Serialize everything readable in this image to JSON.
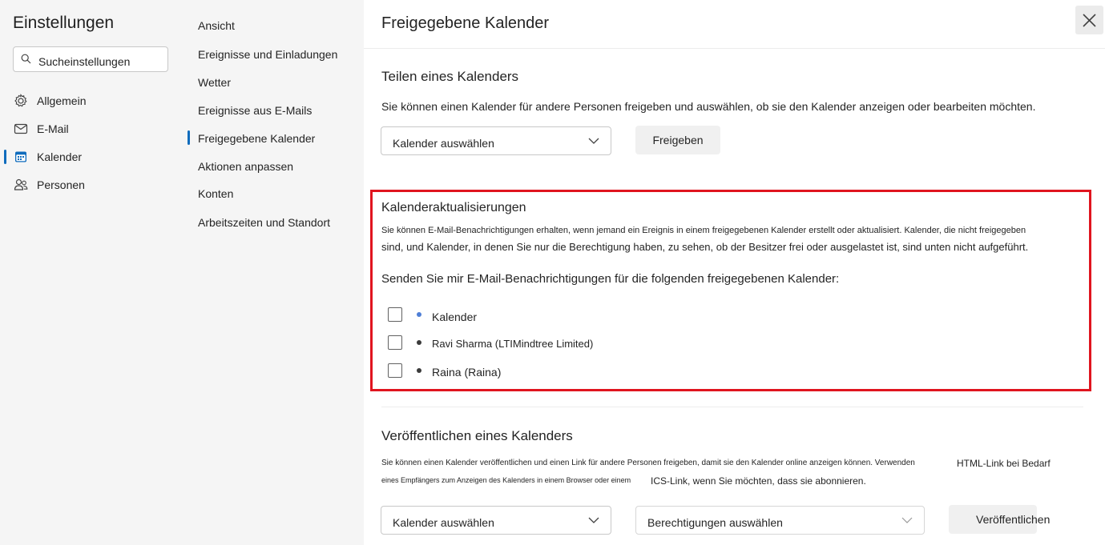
{
  "sidebar": {
    "title": "Einstellungen",
    "search_placeholder": "Sucheinstellungen",
    "items": [
      {
        "label": "Allgemein",
        "icon": "gear-icon"
      },
      {
        "label": "E-Mail",
        "icon": "mail-icon"
      },
      {
        "label": "Kalender",
        "icon": "calendar-icon",
        "selected": true
      },
      {
        "label": "Personen",
        "icon": "people-icon"
      }
    ]
  },
  "subnav": {
    "items": [
      {
        "label": "Ansicht"
      },
      {
        "label": "Ereignisse und Einladungen"
      },
      {
        "label": "Wetter"
      },
      {
        "label": "Ereignisse aus E-Mails"
      },
      {
        "label": "Freigegebene Kalender",
        "selected": true
      },
      {
        "label": "Aktionen anpassen"
      },
      {
        "label": "Konten"
      },
      {
        "label": "Arbeitszeiten und Standort"
      }
    ]
  },
  "main": {
    "title": "Freigegebene Kalender",
    "share": {
      "heading": "Teilen eines Kalenders",
      "description": "Sie können einen Kalender für andere Personen freigeben und auswählen, ob sie den Kalender anzeigen oder bearbeiten möchten.",
      "select_value": "Kalender auswählen",
      "button": "Freigeben"
    },
    "updates": {
      "heading": "Kalenderaktualisierungen",
      "desc_line1": "Sie können E-Mail-Benachrichtigungen erhalten, wenn jemand ein Ereignis in einem freigegebenen Kalender erstellt oder aktualisiert. Kalender, die nicht freigegeben",
      "desc_line2": "sind, und Kalender, in denen Sie nur die Berechtigung haben, zu sehen, ob der Besitzer frei oder ausgelastet ist, sind unten nicht aufgeführt.",
      "prompt": "Senden Sie mir E-Mail-Benachrichtigungen für die folgenden freigegebenen Kalender:",
      "calendars": [
        {
          "label": "Kalender",
          "checked": false,
          "color": "#4f7fd6"
        },
        {
          "label": "Ravi Sharma (LTIMindtree Limited)",
          "checked": false,
          "color": "#3b3b3b"
        },
        {
          "label": "Raina (Raina)",
          "checked": false,
          "color": "#3b3b3b"
        }
      ]
    },
    "publish": {
      "heading": "Veröffentlichen eines Kalenders",
      "desc_line1": "Sie können einen Kalender veröffentlichen und einen Link für andere Personen freigeben, damit sie den Kalender online anzeigen können. Verwenden",
      "desc_line1_end": "HTML-Link bei Bedarf",
      "desc_line2": "eines Empfängers zum Anzeigen des Kalenders in einem Browser oder einem",
      "desc_line2_end": "ICS-Link, wenn Sie möchten, dass sie abonnieren.",
      "calendar_select": "Kalender auswählen",
      "permission_select": "Berechtigungen auswählen",
      "button": "Veröffentlichen"
    }
  },
  "colors": {
    "accent": "#0f6cbd",
    "highlight": "#e0151f"
  }
}
